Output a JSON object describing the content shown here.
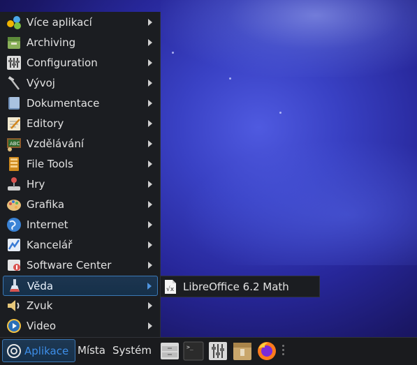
{
  "menu": {
    "items": [
      {
        "label": "Více aplikací",
        "icon": "more-apps-icon"
      },
      {
        "label": "Archiving",
        "icon": "archive-icon"
      },
      {
        "label": "Configuration",
        "icon": "settings-sliders-icon"
      },
      {
        "label": "Vývoj",
        "icon": "development-hammer-icon"
      },
      {
        "label": "Dokumentace",
        "icon": "documentation-book-icon"
      },
      {
        "label": "Editory",
        "icon": "editor-notepad-icon"
      },
      {
        "label": "Vzdělávání",
        "icon": "education-blackboard-icon"
      },
      {
        "label": "File Tools",
        "icon": "file-tools-icon"
      },
      {
        "label": "Hry",
        "icon": "games-joystick-icon"
      },
      {
        "label": "Grafika",
        "icon": "graphics-palette-icon"
      },
      {
        "label": "Internet",
        "icon": "internet-globe-icon"
      },
      {
        "label": "Kancelář",
        "icon": "office-icon"
      },
      {
        "label": "Software Center",
        "icon": "software-center-icon"
      },
      {
        "label": "Věda",
        "icon": "science-icon"
      },
      {
        "label": "Zvuk",
        "icon": "sound-speaker-icon"
      },
      {
        "label": "Video",
        "icon": "video-play-icon"
      }
    ],
    "active_label": "Věda"
  },
  "submenu": {
    "items": [
      {
        "label": "LibreOffice 6.2 Math",
        "icon": "libreoffice-math-icon"
      }
    ]
  },
  "panel": {
    "applications_label": "Aplikace",
    "places_label": "Místa",
    "system_label": "Systém",
    "launchers": [
      "drawer-icon",
      "terminal-icon",
      "settings-mixer-icon",
      "archive-manager-icon",
      "firefox-icon"
    ]
  },
  "colors": {
    "accent": "#3b78b5",
    "accent_text": "#3d8ee8",
    "menu_bg": "#1b1d21",
    "text": "#e3e3e3"
  }
}
